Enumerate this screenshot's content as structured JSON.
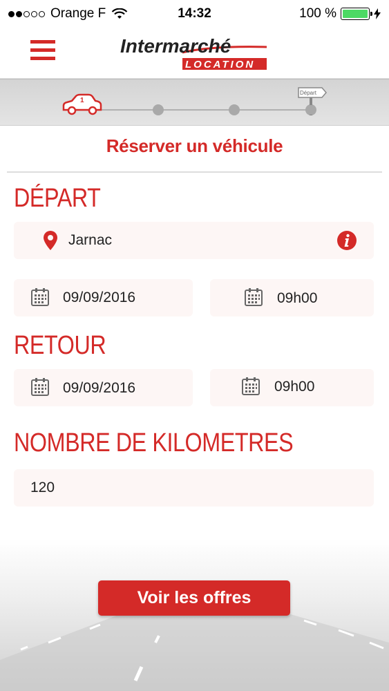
{
  "status": {
    "carrier": "Orange F",
    "time": "14:32",
    "battery": "100 %"
  },
  "header": {
    "logo_top": "Intermarché",
    "logo_bottom": "LOCATION"
  },
  "progress": {
    "step_number": "1",
    "flag_label": "Départ"
  },
  "page": {
    "title": "Réserver un véhicule"
  },
  "depart": {
    "heading": "DÉPART",
    "location": "Jarnac",
    "date": "09/09/2016",
    "time": "09h00"
  },
  "retour": {
    "heading": "RETOUR",
    "date": "09/09/2016",
    "time": "09h00"
  },
  "km": {
    "heading": "NOMBRE DE KILOMETRES",
    "value": "120"
  },
  "cta": {
    "label": "Voir les offres"
  },
  "colors": {
    "brand_red": "#d42a28",
    "battery_green": "#4cd964"
  }
}
